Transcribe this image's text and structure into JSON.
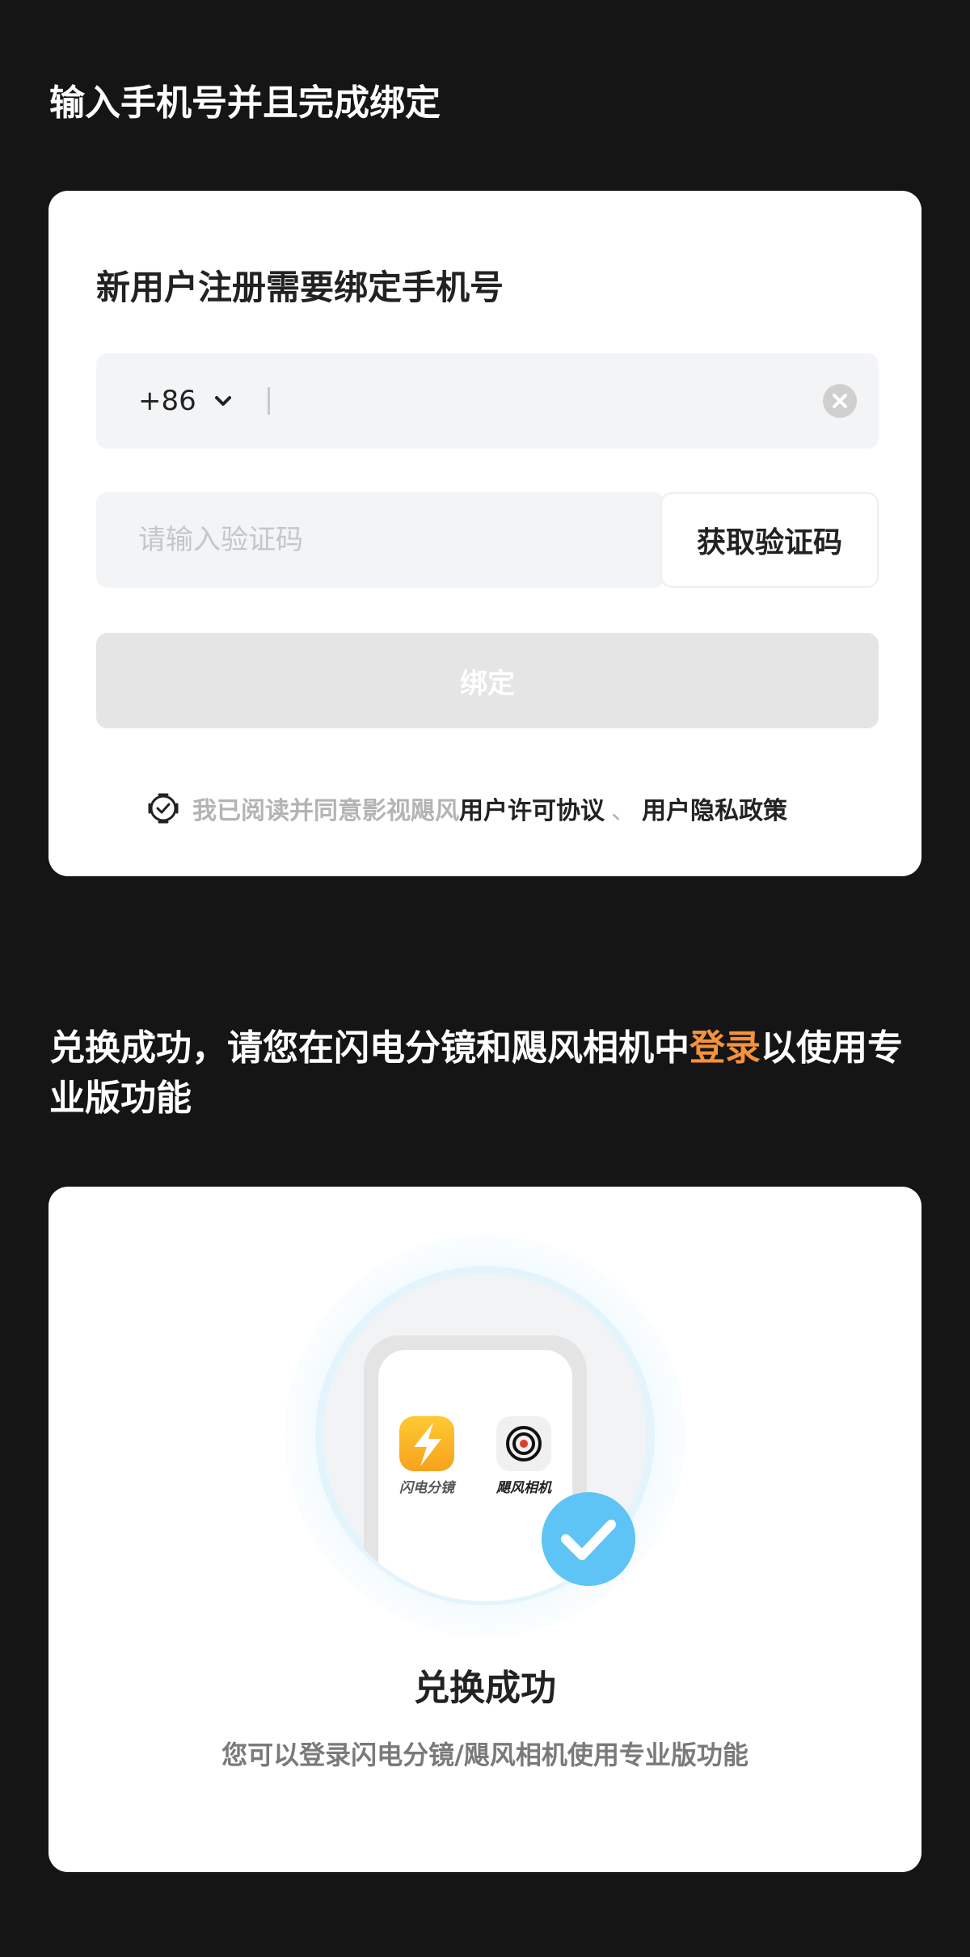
{
  "section1": {
    "title": "输入手机号并且完成绑定"
  },
  "form": {
    "heading": "新用户注册需要绑定手机号",
    "country_code": "+86",
    "phone_value": "",
    "code_placeholder": "请输入验证码",
    "get_code_label": "获取验证码",
    "bind_label": "绑定",
    "agreement_prefix": "我已阅读并同意影视飓风",
    "user_agreement": "用户许可协议",
    "separator": "、",
    "privacy_policy": "用户隐私政策",
    "agreement_checked": true
  },
  "section2": {
    "title_before": "兑换成功，请您在闪电分镜和飓风相机中",
    "title_highlight": "登录",
    "title_after": "以使用专业版功能"
  },
  "success": {
    "app1_label": "闪电分镜",
    "app2_label": "飓风相机",
    "title": "兑换成功",
    "subtitle": "您可以登录闪电分镜/飓风相机使用专业版功能"
  },
  "colors": {
    "page_bg": "#151515",
    "accent": "#f5923a",
    "check_blue": "#5ec4f5",
    "disabled_button": "#e5e5e5"
  },
  "icons": {
    "chevron": "chevron-down-icon",
    "clear": "clear-circle-icon",
    "agree": "checkbox-checked-icon",
    "success": "check-circle-icon",
    "app1": "lightning-app-icon",
    "app2": "camera-lens-app-icon"
  }
}
